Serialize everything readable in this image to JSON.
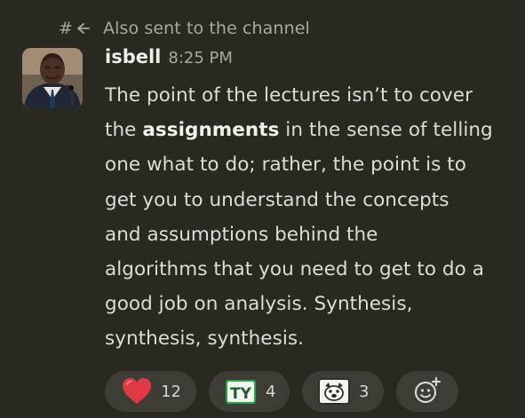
{
  "thread": {
    "icon": "channel-thread-icon",
    "text": "Also sent to the channel"
  },
  "message": {
    "author": "isbell",
    "time": "8:25 PM",
    "avatar": "user-avatar",
    "lines": [
      [
        "The point of the lectures isn’t to cover"
      ],
      [
        "the ",
        "assignments",
        " in the sense of telling"
      ],
      [
        "one what to do; rather, the point is to"
      ],
      [
        "get you to understand the concepts"
      ],
      [
        "and assumptions behind the"
      ],
      [
        "algorithms that you need to get to do a"
      ],
      [
        "good job on analysis. Synthesis,"
      ],
      [
        "synthesis, synthesis."
      ]
    ]
  },
  "reactions": [
    {
      "emoji": "heart-icon",
      "count": "12"
    },
    {
      "emoji": "ty-icon",
      "emoji_text": "TY",
      "count": "4"
    },
    {
      "emoji": "dog-face-icon",
      "count": "3"
    }
  ],
  "reaction_add": {
    "icon": "add-reaction-icon"
  },
  "colors": {
    "background": "#2a2920",
    "reaction_bg": "#3d3c35",
    "text": "#dcdcd9",
    "muted": "#a8a8a1",
    "heart": "#e03844",
    "ty_green": "#23a548"
  }
}
